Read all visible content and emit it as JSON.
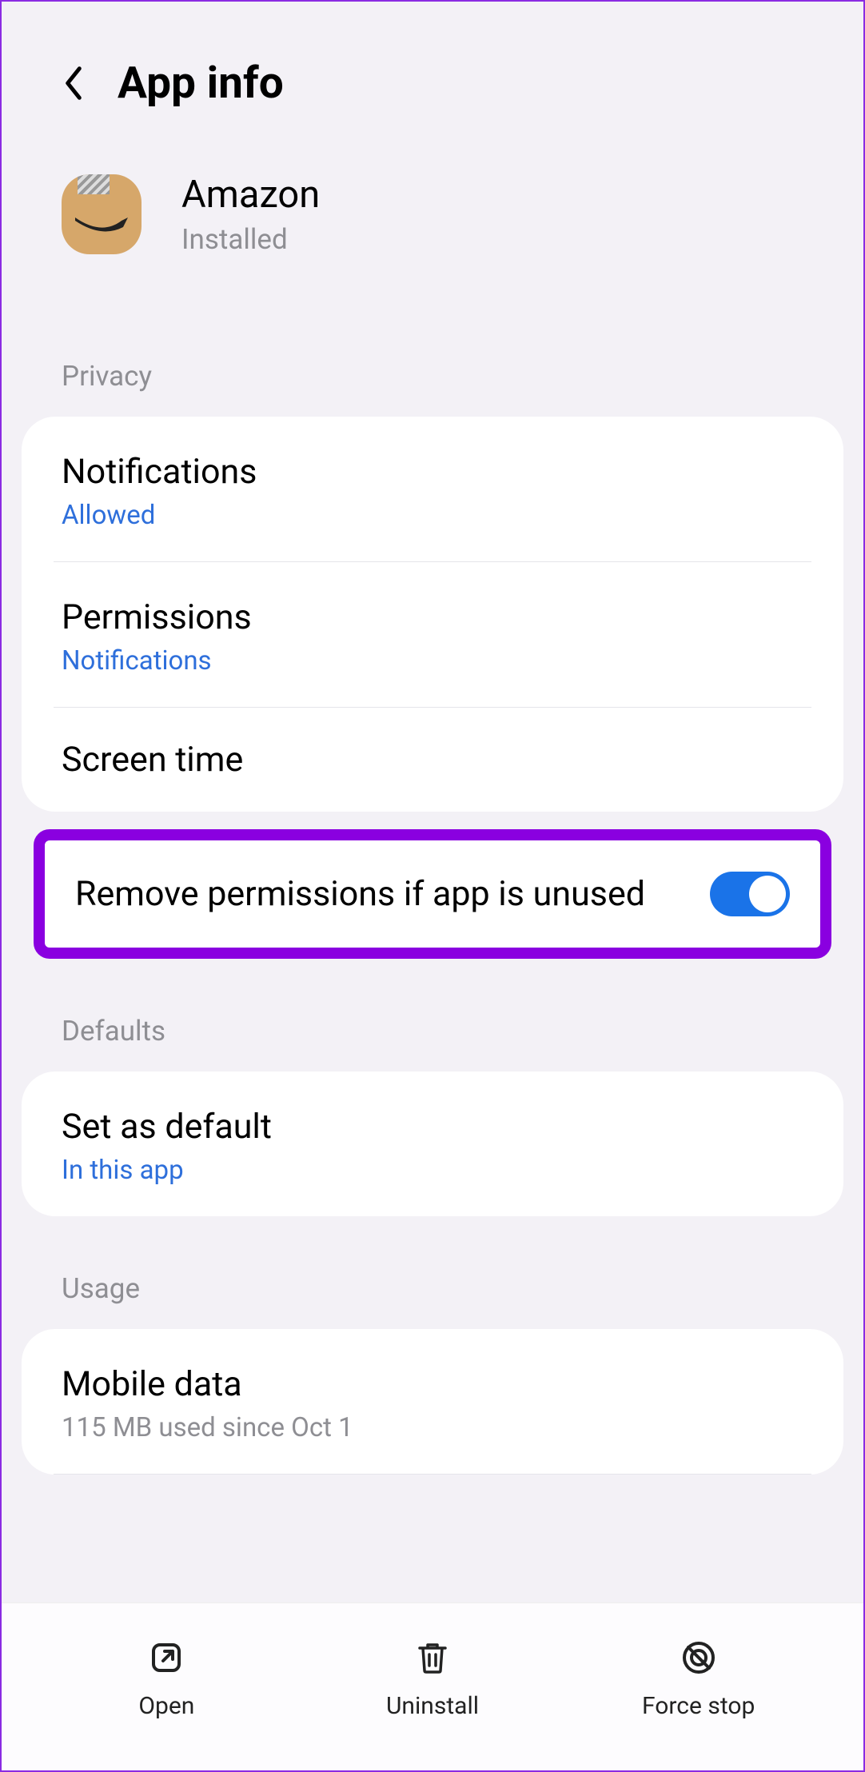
{
  "header": {
    "title": "App info"
  },
  "app": {
    "name": "Amazon",
    "status": "Installed"
  },
  "sections": {
    "privacy": {
      "header": "Privacy",
      "notifications": {
        "title": "Notifications",
        "sub": "Allowed"
      },
      "permissions": {
        "title": "Permissions",
        "sub": "Notifications"
      },
      "screenTime": {
        "title": "Screen time"
      },
      "removePermissions": {
        "title": "Remove permissions if app is unused",
        "enabled": true
      }
    },
    "defaults": {
      "header": "Defaults",
      "setDefault": {
        "title": "Set as default",
        "sub": "In this app"
      }
    },
    "usage": {
      "header": "Usage",
      "mobileData": {
        "title": "Mobile data",
        "sub": "115 MB used since Oct 1"
      }
    }
  },
  "bottomBar": {
    "open": "Open",
    "uninstall": "Uninstall",
    "forceStop": "Force stop"
  }
}
